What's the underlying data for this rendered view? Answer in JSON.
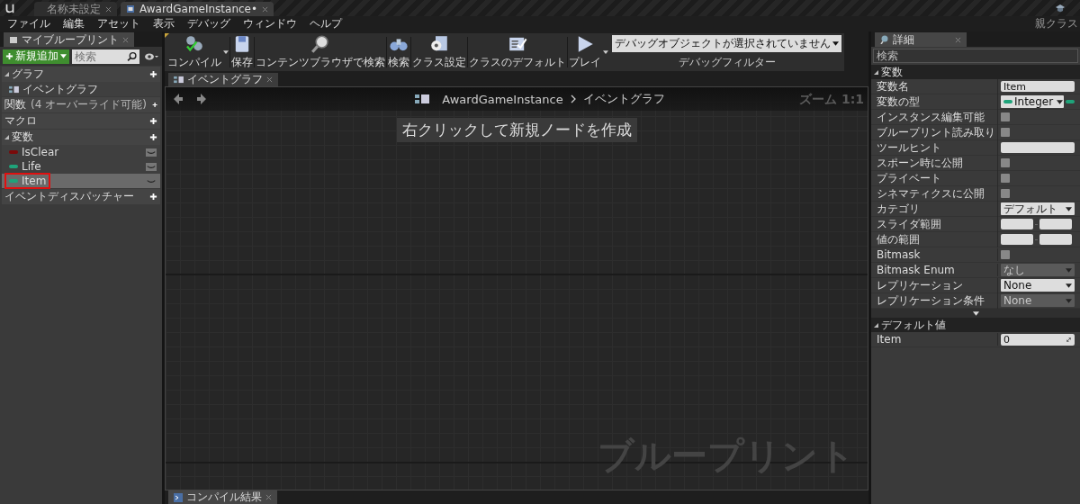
{
  "app_tabs": [
    {
      "label": "名称未設定",
      "selected": false
    },
    {
      "label": "AwardGameInstance•",
      "selected": true
    }
  ],
  "menu": [
    "ファイル",
    "編集",
    "アセット",
    "表示",
    "デバッグ",
    "ウィンドウ",
    "ヘルプ"
  ],
  "parent_class_label": "親クラス",
  "my_blueprint": {
    "tab": "マイブループリント",
    "add_button": "新規追加",
    "search_placeholder": "検索",
    "sections": [
      {
        "label": "グラフ",
        "expanded": true,
        "items": [
          {
            "kind": "graph",
            "label": "イベントグラフ",
            "selected": false
          }
        ]
      },
      {
        "label": "関数",
        "note": "(4 オーバーライド可能)"
      },
      {
        "label": "マクロ"
      },
      {
        "label": "変数",
        "expanded": true,
        "items": [
          {
            "kind": "variable",
            "label": "IsClear",
            "color": "#7a0a0a",
            "selected": false
          },
          {
            "kind": "variable",
            "label": "Life",
            "color": "#1fa37a",
            "selected": false
          },
          {
            "kind": "variable",
            "label": "Item",
            "color": "#1fa37a",
            "selected": true
          }
        ]
      },
      {
        "label": "イベントディスパッチャー"
      }
    ]
  },
  "toolbar": [
    {
      "kind": "compile",
      "label": "コンパイル",
      "dropdown": true
    },
    {
      "kind": "save",
      "label": "保存",
      "dropdown": false
    },
    {
      "kind": "browse",
      "label": "コンテンツブラウザで検索",
      "dropdown": false
    },
    {
      "kind": "find",
      "label": "検索",
      "dropdown": false
    },
    {
      "kind": "class-settings",
      "label": "クラス設定",
      "dropdown": false
    },
    {
      "kind": "class-defaults",
      "label": "クラスのデフォルト",
      "dropdown": false
    },
    {
      "kind": "play",
      "label": "プレイ",
      "dropdown": true
    }
  ],
  "debug_filter": {
    "value": "デバッグオブジェクトが選択されていません",
    "label": "デバッグフィルター"
  },
  "graph": {
    "tab": "イベントグラフ",
    "breadcrumb": [
      "AwardGameInstance",
      "イベントグラフ"
    ],
    "zoom": "ズーム 1:1",
    "hint": "右クリックして新規ノードを作成",
    "corner_label": "ブループリント"
  },
  "details": {
    "tab": "詳細",
    "search_placeholder": "検索",
    "sections": [
      {
        "label": "変数",
        "rows": [
          {
            "kind": "text",
            "label": "変数名",
            "value": "Item"
          },
          {
            "kind": "type",
            "label": "変数の型",
            "value": "Integer",
            "color": "#1fa37a"
          },
          {
            "kind": "checkbox",
            "label": "インスタンス編集可能",
            "checked": false
          },
          {
            "kind": "checkbox",
            "label": "ブループリント読み取り",
            "checked": false
          },
          {
            "kind": "text",
            "label": "ツールヒント"
          },
          {
            "kind": "checkbox",
            "label": "スポーン時に公開",
            "checked": false
          },
          {
            "kind": "checkbox",
            "label": "プライベート",
            "checked": false
          },
          {
            "kind": "checkbox",
            "label": "シネマティクスに公開",
            "checked": false
          },
          {
            "kind": "dropdown",
            "label": "カテゴリ",
            "value": "デフォルト",
            "disabled": false
          },
          {
            "kind": "range",
            "label": "スライダ範囲"
          },
          {
            "kind": "range",
            "label": "値の範囲"
          },
          {
            "kind": "checkbox",
            "label": "Bitmask",
            "checked": false
          },
          {
            "kind": "dropdown",
            "label": "Bitmask Enum",
            "value": "なし",
            "disabled": true
          },
          {
            "kind": "dropdown",
            "label": "レプリケーション",
            "value": "None",
            "disabled": false
          },
          {
            "kind": "dropdown",
            "label": "レプリケーション条件",
            "value": "None",
            "disabled": true
          }
        ],
        "more": true
      },
      {
        "label": "デフォルト値",
        "rows": [
          {
            "kind": "number",
            "label": "Item",
            "value": "0"
          }
        ],
        "more": false
      }
    ]
  },
  "bottom_tab": "コンパイル結果"
}
